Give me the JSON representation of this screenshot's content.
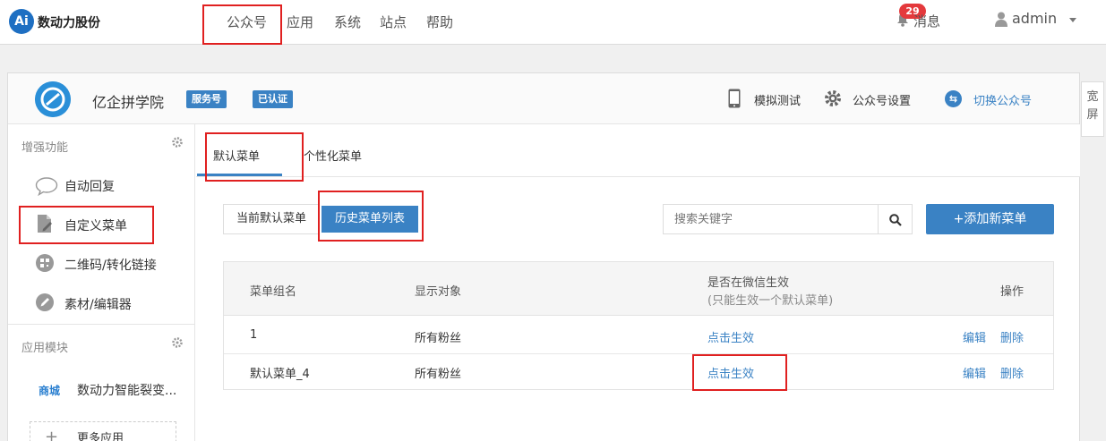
{
  "topbar": {
    "logo_mark": "Ai",
    "brand": "数动力股份",
    "nav": [
      "公众号",
      "应用",
      "系统",
      "站点",
      "帮助"
    ],
    "message_count": "29",
    "message_label": "消息",
    "user": "admin"
  },
  "account": {
    "name": "亿企拼学院",
    "badges": [
      "服务号",
      "已认证"
    ],
    "simulate_label": "模拟测试",
    "settings_label": "公众号设置",
    "switch_icon": "⇆",
    "switch_label": "切换公众号",
    "wide_screen": "宽屏"
  },
  "sidebar": {
    "section1": "增强功能",
    "items": [
      "自动回复",
      "自定义菜单",
      "二维码/转化链接",
      "素材/编辑器"
    ],
    "section2": "应用模块",
    "app_tag": "商城",
    "app_name": "数动力智能裂变...",
    "more_icon": "+",
    "more_label": "更多应用"
  },
  "tabs": [
    "默认菜单",
    "个性化菜单"
  ],
  "toolbar": {
    "current_label": "当前默认菜单",
    "history_label": "历史菜单列表",
    "search_placeholder": "搜索关键字",
    "add_label": "+添加新菜单"
  },
  "table": {
    "headers": {
      "name": "菜单组名",
      "target": "显示对象",
      "effective": "是否在微信生效",
      "effective_note": "(只能生效一个默认菜单)",
      "ops": "操作"
    },
    "rows": [
      {
        "name": "1",
        "target": "所有粉丝",
        "action": "点击生效",
        "edit": "编辑",
        "delete": "删除"
      },
      {
        "name": "默认菜单_4",
        "target": "所有粉丝",
        "action": "点击生效",
        "edit": "编辑",
        "delete": "删除"
      }
    ]
  },
  "colors": {
    "accent": "#3a82c4",
    "badge_red": "#e4393c",
    "annotation": "#e02020"
  }
}
